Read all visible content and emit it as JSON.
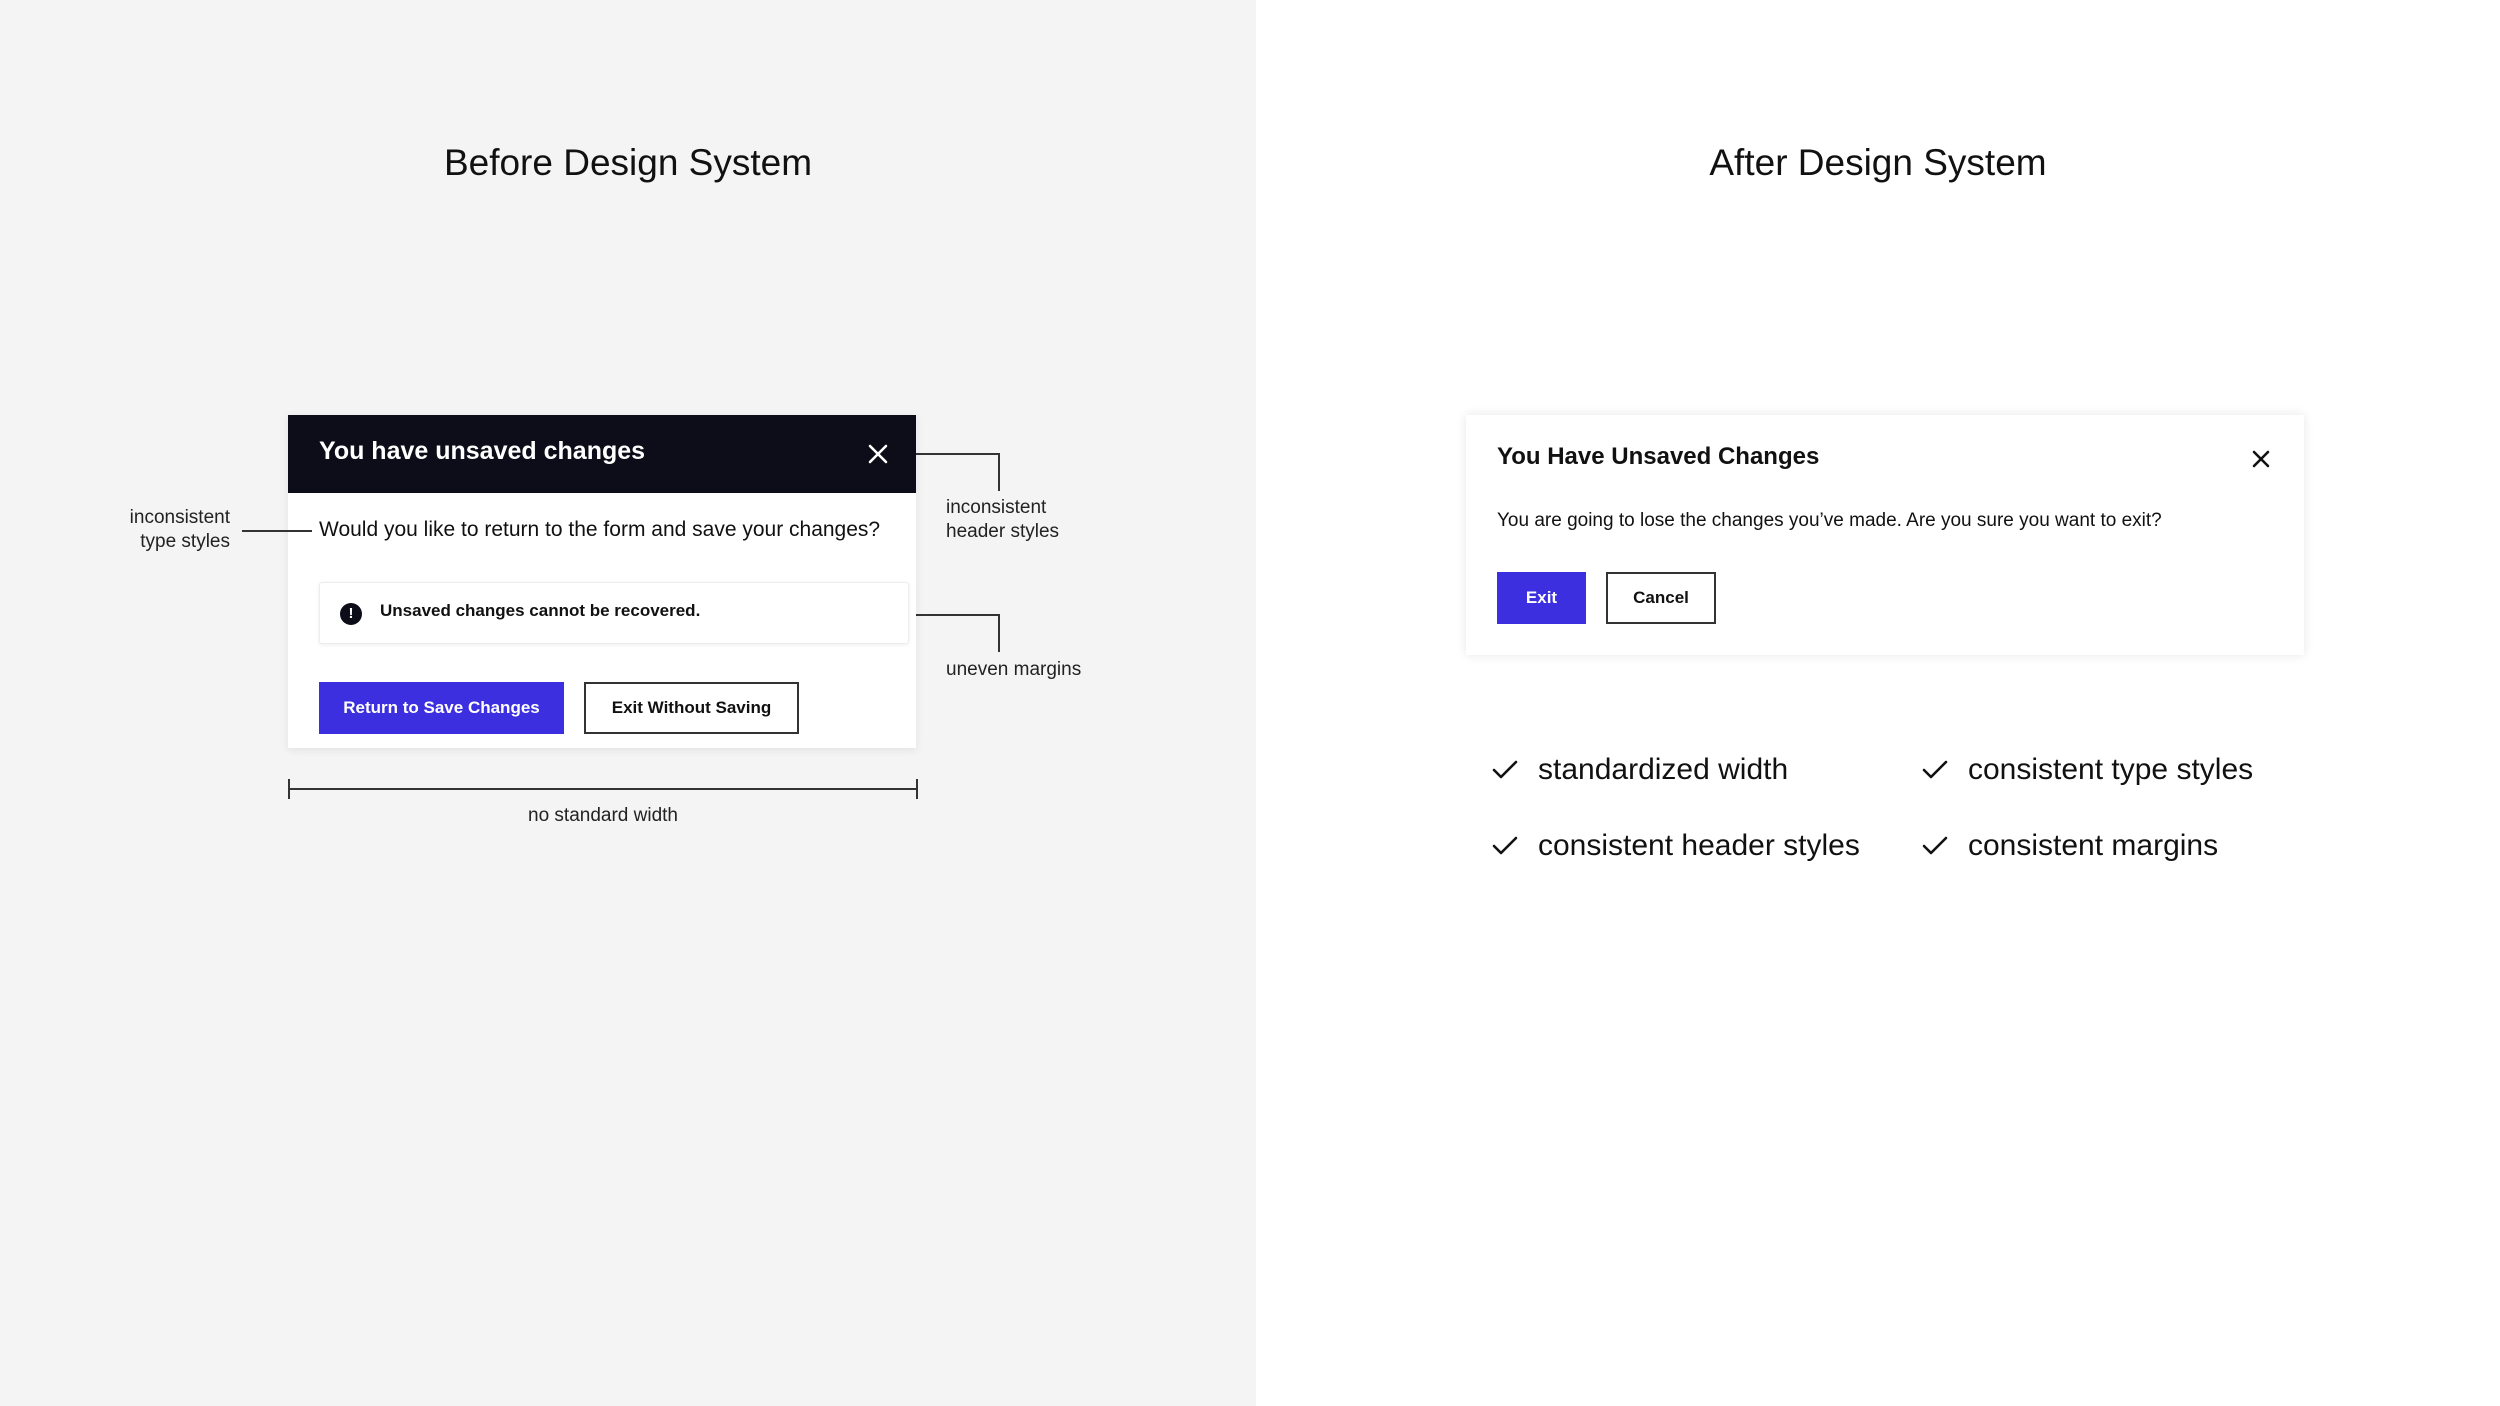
{
  "before": {
    "title": "Before Design System",
    "dialog": {
      "title": "You have unsaved changes",
      "question": "Would you like to return to the form and save your changes?",
      "alert_text": "Unsaved changes cannot be recovered.",
      "primary_button": "Return to Save Changes",
      "secondary_button": "Exit Without Saving"
    },
    "annotations": {
      "type_styles": [
        "inconsistent",
        "type styles"
      ],
      "header_styles": [
        "inconsistent",
        "header styles"
      ],
      "margins": "uneven margins",
      "width": "no standard width"
    }
  },
  "after": {
    "title": "After Design System",
    "dialog": {
      "title": "You Have Unsaved Changes",
      "body": "You are going to lose the changes you’ve made. Are you sure you want to exit?",
      "primary_button": "Exit",
      "secondary_button": "Cancel"
    },
    "checklist": [
      "standardized width",
      "consistent type styles",
      "consistent header styles",
      "consistent margins"
    ]
  },
  "colors": {
    "accent": "#3c2fe0",
    "header_dark": "#0c0d18",
    "left_background": "#f4f4f4",
    "right_background": "#ffffff"
  },
  "icons": {
    "close": "close-icon",
    "alert": "exclamation-circle-icon",
    "check": "check-icon"
  }
}
